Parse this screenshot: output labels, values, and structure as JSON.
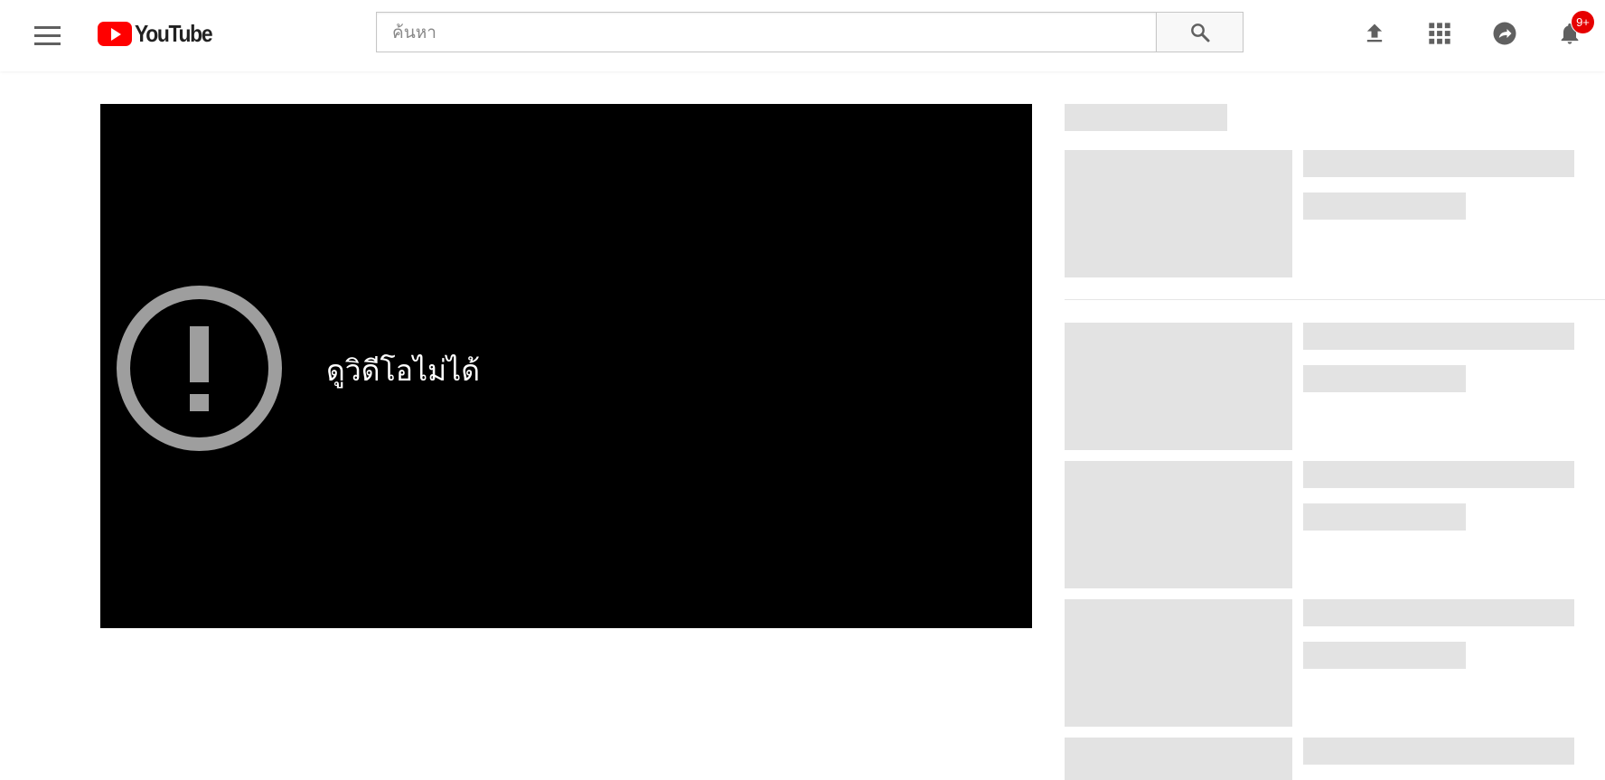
{
  "masthead": {
    "logo_text": "YouTube",
    "search": {
      "placeholder": "ค้นหา",
      "value": "",
      "icon": "search-icon"
    },
    "icons": [
      "menu-icon",
      "upload-icon",
      "apps-grid-icon",
      "messages-icon",
      "bell-icon"
    ],
    "notification_count": "9+"
  },
  "player": {
    "error_message": "ดูวิดีโอไม่ได้",
    "error_icon": "alert-circle-icon"
  },
  "sidebar": {
    "state": "loading-skeleton",
    "placeholder_items": 5
  },
  "colors": {
    "brand_red": "#ff0000",
    "badge_red": "#e60000",
    "icon_gray": "#606060",
    "skeleton": "#e3e3e3"
  }
}
